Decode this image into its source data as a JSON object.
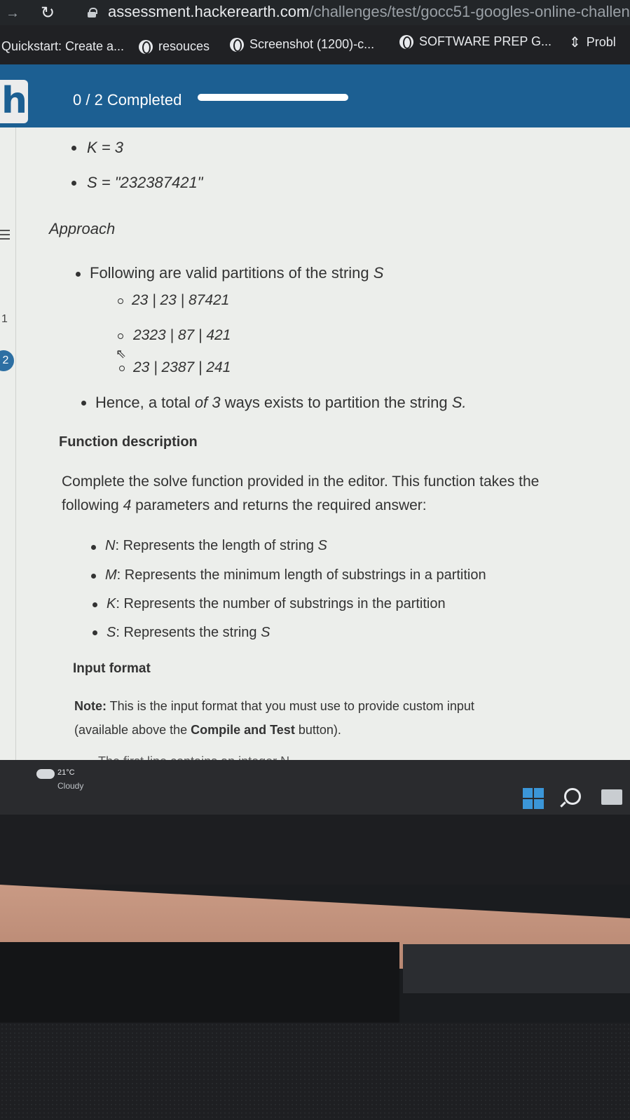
{
  "browser": {
    "url_host": "assessment.hackerearth.com",
    "url_path": "/challenges/test/gocc51-googles-online-challen",
    "bookmarks": [
      {
        "label": "Quickstart: Create a..."
      },
      {
        "label": "resouces"
      },
      {
        "label": "Screenshot (1200)-c..."
      },
      {
        "label": "SOFTWARE PREP G..."
      },
      {
        "label": "Probl"
      }
    ]
  },
  "header": {
    "progress_text": "0 / 2 Completed",
    "progress_fraction": 1.0
  },
  "sidebar": {
    "questions": [
      "1",
      "2"
    ],
    "active_question": "2"
  },
  "problem": {
    "example_params": [
      {
        "text": "K = 3"
      },
      {
        "text": "S = \"232387421\""
      }
    ],
    "approach_heading": "Approach",
    "approach_intro_prefix": "Following are valid partitions of the string ",
    "approach_intro_var": "S",
    "partitions": [
      "23 | 23 | 87421",
      "2323 | 87 | 421",
      "23 | 2387 | 241"
    ],
    "conclusion_a": "Hence, a total ",
    "conclusion_b": "of 3",
    "conclusion_c": " ways exists to partition the string ",
    "conclusion_var": "S.",
    "function_heading": "Function description",
    "function_desc_line1": "Complete the solve function provided in the editor. This function takes the",
    "function_desc_line2_a": "following ",
    "function_desc_line2_num": "4",
    "function_desc_line2_b": " parameters and returns the required answer:",
    "parameters": [
      {
        "name": "N",
        "desc": ": Represents the length of string ",
        "var": "S"
      },
      {
        "name": "M",
        "desc": ": Represents the minimum length of substrings in a partition",
        "var": ""
      },
      {
        "name": "K",
        "desc": ": Represents the number of substrings in the partition",
        "var": ""
      },
      {
        "name": "S",
        "desc": ": Represents the string ",
        "var": "S"
      }
    ],
    "input_heading": "Input format",
    "note_label": "Note:",
    "note_line1": " This is the input format that you must use to provide custom input",
    "note_line2_a": "(available above the ",
    "note_line2_b": "Compile and Test",
    "note_line2_c": " button).",
    "cut_line": "The first line contains an integer N"
  },
  "taskbar": {
    "weather_temp": "21°C",
    "weather_desc": "Cloudy"
  },
  "icons": [
    "back-arrow-icon",
    "reload-icon",
    "lock-icon",
    "globe-icon",
    "bookmark-folder-icon",
    "menu-icon",
    "cursor-icon",
    "weather-icon",
    "windows-start-icon",
    "search-icon",
    "task-view-icon"
  ]
}
